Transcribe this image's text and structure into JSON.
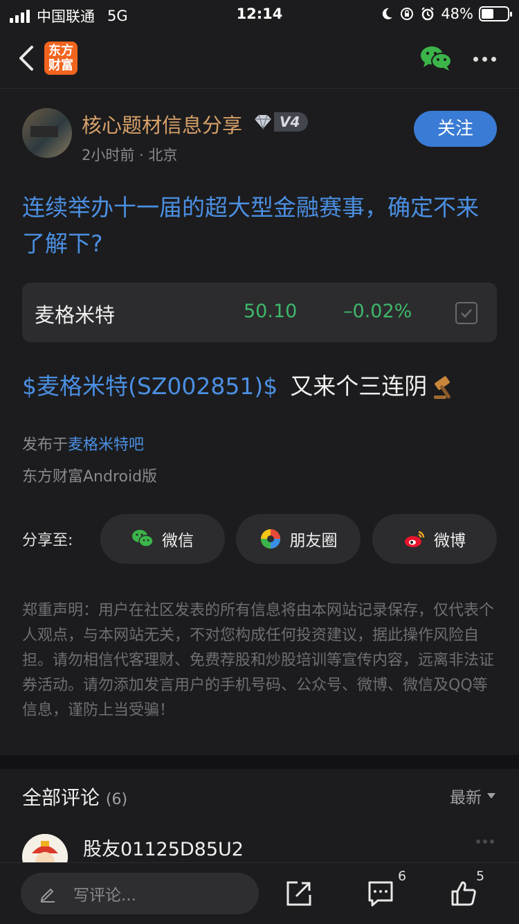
{
  "status_bar": {
    "carrier": "中国联通",
    "network": "5G",
    "time": "12:14",
    "battery": "48%",
    "battery_level": 0.48
  },
  "nav": {
    "logo_line1": "东方",
    "logo_line2": "财富"
  },
  "author": {
    "name": "核心题材信息分享",
    "level": "V4",
    "meta": "2小时前 · 北京",
    "follow_label": "关注"
  },
  "post": {
    "title": "连续举办十一届的超大型金融赛事，确定不来了解下?",
    "stock_link": "$麦格米特(SZ002851)$",
    "text": "又来个三连阴"
  },
  "stock_card": {
    "name": "麦格米特",
    "price": "50.10",
    "change": "–0.02%"
  },
  "published": {
    "prefix": "发布于",
    "bar_name": "麦格米特吧",
    "client": "东方财富Android版"
  },
  "share": {
    "label": "分享至:",
    "wechat": "微信",
    "moments": "朋友圈",
    "weibo": "微博"
  },
  "disclaimer": "郑重声明：用户在社区发表的所有信息将由本网站记录保存，仅代表个人观点，与本网站无关，不对您构成任何投资建议，据此操作风险自担。请勿相信代客理财、免费荐股和炒股培训等宣传内容，远离非法证券活动。请勿添加发言用户的手机号码、公众号、微博、微信及QQ等信息，谨防上当受骗！",
  "comments": {
    "title": "全部评论",
    "count": "(6)",
    "sort": "最新",
    "first_user": "股友01125D85U2"
  },
  "bottom_bar": {
    "placeholder": "写评论...",
    "comment_count": "6",
    "like_count": "5"
  },
  "colors": {
    "background": "#1c1c1e",
    "link_blue": "#4b8fe2",
    "gain_green": "#3eb86a",
    "author_gold": "#d7a16a",
    "follow_blue": "#3a7bd5"
  }
}
